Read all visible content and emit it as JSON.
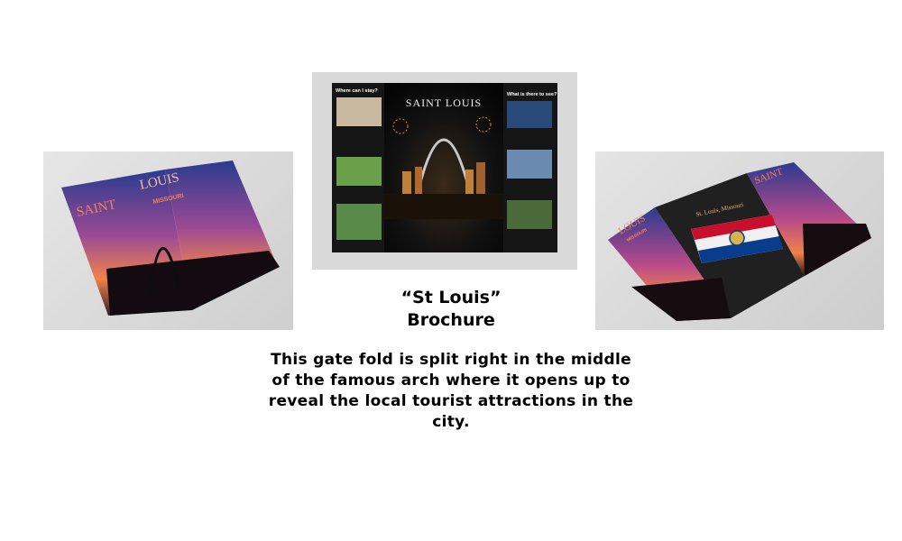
{
  "title_line1": "“St Louis”",
  "title_line2": "Brochure",
  "description": "This gate fold is split right in the middle of the famous arch where it opens up to reveal the local tourist attractions in the city.",
  "left_mockup": {
    "word1": "SAINT",
    "word2": "LOUIS",
    "word3": "MISSOURI"
  },
  "center_mockup": {
    "heading": "SAINT LOUIS",
    "left_heading": "Where can I stay?",
    "right_heading": "What is there to see?"
  },
  "right_mockup": {
    "word_saint": "SAINT",
    "word_louis": "LOUIS",
    "word_missouri": "MISSOURI",
    "thanks_line": "St. Louis, Missouri"
  },
  "colors": {
    "sky_top": "#2a3b8f",
    "sky_mid": "#b84a8a",
    "sky_low": "#f0824a",
    "dark_panel": "#1b1b1b",
    "flag_red": "#c8102e",
    "flag_blue": "#0a3c8c"
  }
}
